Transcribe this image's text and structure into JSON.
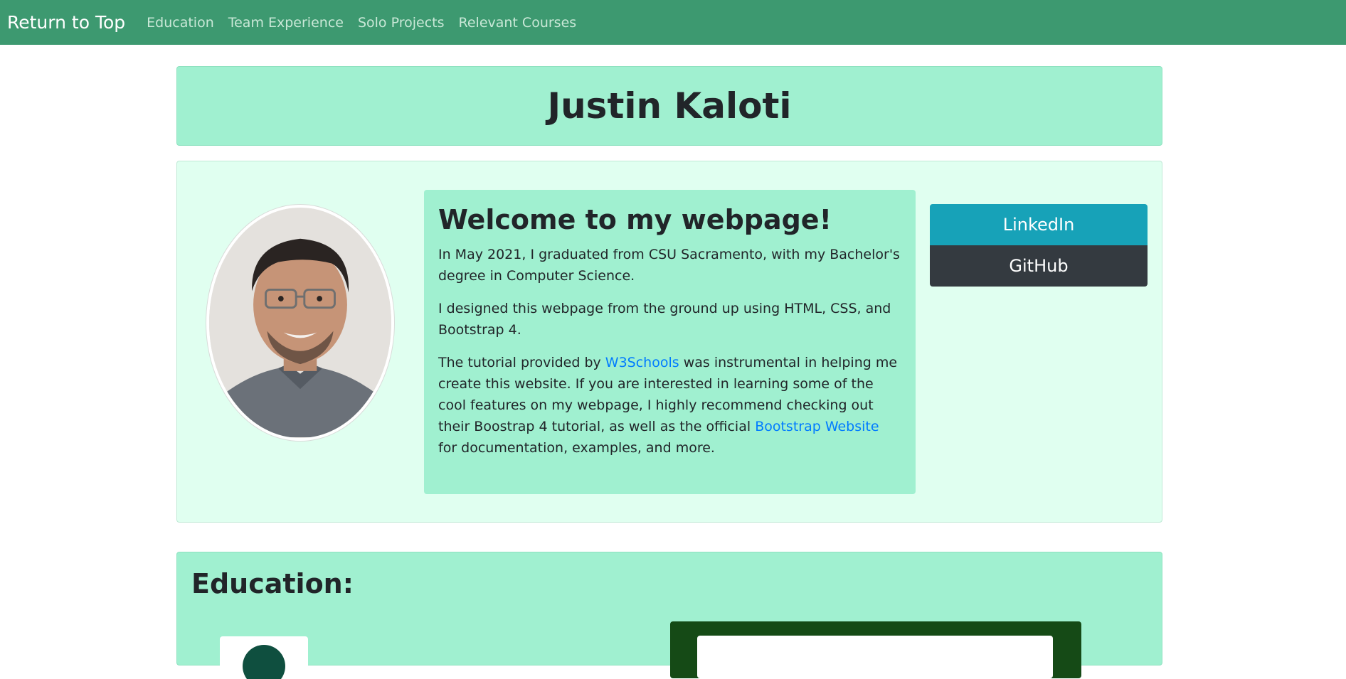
{
  "navbar": {
    "brand": "Return to Top",
    "links": [
      "Education",
      "Team Experience",
      "Solo Projects",
      "Relevant Courses"
    ]
  },
  "header": {
    "name": "Justin Kaloti"
  },
  "welcome": {
    "heading": "Welcome to my webpage!",
    "p1": "In May 2021, I graduated from CSU Sacramento, with my Bachelor's degree in Computer Science.",
    "p2": "I designed this webpage from the ground up using HTML, CSS, and Bootstrap 4.",
    "p3_before": "The tutorial provided by ",
    "p3_link1": "W3Schools",
    "p3_mid": " was instrumental in helping me create this website. If you are interested in learning some of the cool features on my webpage, I highly recommend checking out their Boostrap 4 tutorial, as well as the official ",
    "p3_link2": "Bootstrap Website",
    "p3_after": " for documentation, examples, and more."
  },
  "buttons": {
    "linkedin": "LinkedIn",
    "github": "GitHub"
  },
  "education": {
    "heading": "Education:"
  },
  "colors": {
    "navbar": "#3d9970",
    "mint": "#a0f0d0",
    "light_mint": "#e0fff0",
    "linkedin": "#17a2b8",
    "github": "#343a40",
    "link": "#007bff"
  }
}
